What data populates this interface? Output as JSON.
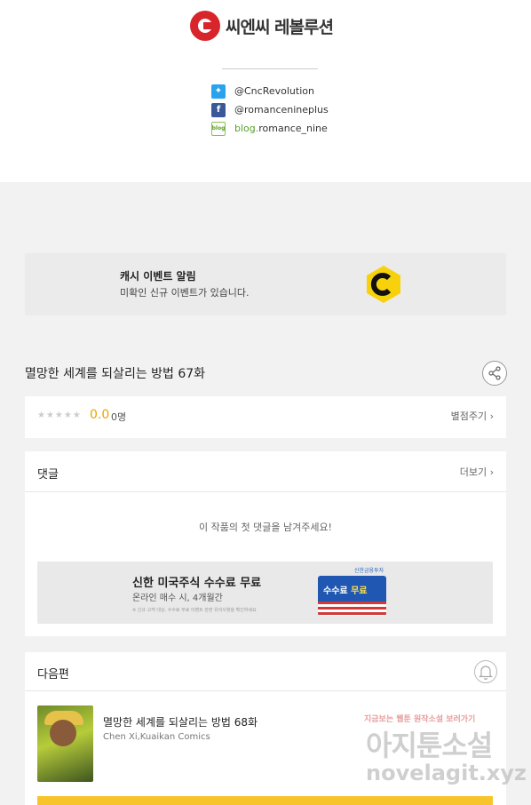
{
  "brand": {
    "logo_text": "씨엔씨 레볼루션"
  },
  "social": {
    "twitter": "@CncRevolution",
    "facebook": "@romancenineplus",
    "blog_prefix": "blog.",
    "blog_handle": "romance_nine",
    "blog_icon_text": "blog"
  },
  "cash_event": {
    "title": "캐시 이벤트 알림",
    "subtitle": "미확인 신규 이벤트가 있습니다."
  },
  "episode": {
    "title": "멸망한 세계를 되살리는 방법 67화"
  },
  "rating": {
    "stars": "★★★★★",
    "score": "0.0",
    "count": "0명",
    "rate_button": "별점주기 ›"
  },
  "comments": {
    "title": "댓글",
    "more": "더보기 ›",
    "empty": "이 작품의 첫 댓글을 남겨주세요!"
  },
  "ad": {
    "brand": "신한금융투자",
    "title": "신한 미국주식 수수료 무료",
    "subtitle": "온라인 매수 시, 4개월간",
    "fine_print": "※ 신규 고객 대상, 수수료 무료 이벤트 관련 유의사항을 확인하세요",
    "badge_text": "수수료",
    "badge_highlight": "무료"
  },
  "next": {
    "title": "다음편",
    "episode_title": "멸망한 세계를 되살리는 방법 68화",
    "author": "Chen Xi,Kuaikan Comics"
  },
  "watermark": {
    "line1": "지금보는 웹툰 원작소설 보러가기",
    "line2": "아지툰소설",
    "line3": "novelagit.xyz"
  },
  "colors": {
    "brand_red": "#d8252b",
    "score_yellow": "#e8a400",
    "cash_yellow": "#f7d20c",
    "cta_yellow": "#f7c52b"
  }
}
